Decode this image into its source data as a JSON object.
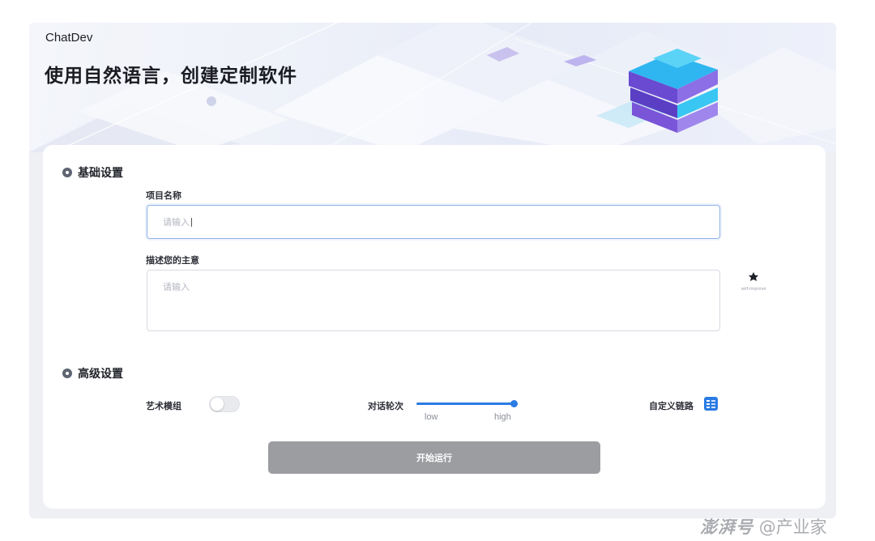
{
  "header": {
    "brand": "ChatDev",
    "title": "使用自然语言，创建定制软件"
  },
  "basic_settings": {
    "title": "基础设置",
    "project_name": {
      "label": "项目名称",
      "placeholder": "请输入"
    },
    "description": {
      "label": "描述您的主意",
      "placeholder": "请输入"
    },
    "self_improve_label": "self-improve"
  },
  "advanced_settings": {
    "title": "高级设置",
    "art_mode": {
      "label": "艺术模组",
      "enabled": false
    },
    "dialog_rounds": {
      "label": "对话轮次",
      "low_label": "low",
      "high_label": "high",
      "level": 1.0
    },
    "custom_chain": {
      "label": "自定义链路"
    }
  },
  "actions": {
    "run_label": "开始运行"
  },
  "watermark": {
    "logo": "澎湃号",
    "text": "@产业家"
  },
  "colors": {
    "accent": "#2a7be4",
    "button_disabled": "#9c9da1",
    "focus_border": "#8fb4e6"
  }
}
